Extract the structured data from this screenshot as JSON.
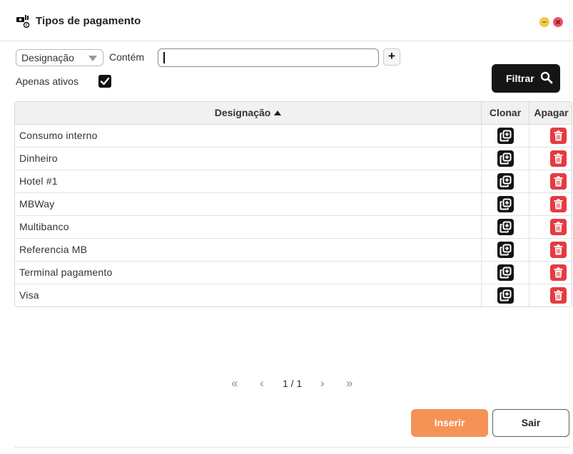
{
  "window": {
    "title": "Tipos de pagamento",
    "icon": "payment-cash-icon",
    "minimize_color": "#f3c84a",
    "close_color": "#ea5468"
  },
  "filter": {
    "field_select": "Designação",
    "operator_label": "Contém",
    "search_value": "",
    "add_condition_label": "+",
    "only_active_label": "Apenas ativos",
    "only_active_checked": true,
    "filter_button_label": "Filtrar",
    "filter_icon": "search-icon"
  },
  "table": {
    "columns": {
      "name": "Designação",
      "clone": "Clonar",
      "delete": "Apagar"
    },
    "sort": "ascending",
    "rows": [
      "Consumo interno",
      "Dinheiro",
      "Hotel #1",
      "MBWay",
      "Multibanco",
      "Referencia MB",
      "Terminal pagamento",
      "Visa"
    ],
    "clone_icon": "clone-icon",
    "delete_icon": "trash-icon",
    "delete_color": "#e43b40"
  },
  "pagination": {
    "first": "«",
    "prev": "‹",
    "info": "1 / 1",
    "next": "›",
    "last": "»"
  },
  "actions": {
    "insert_label": "Inserir",
    "exit_label": "Sair",
    "insert_color": "#f59356"
  }
}
